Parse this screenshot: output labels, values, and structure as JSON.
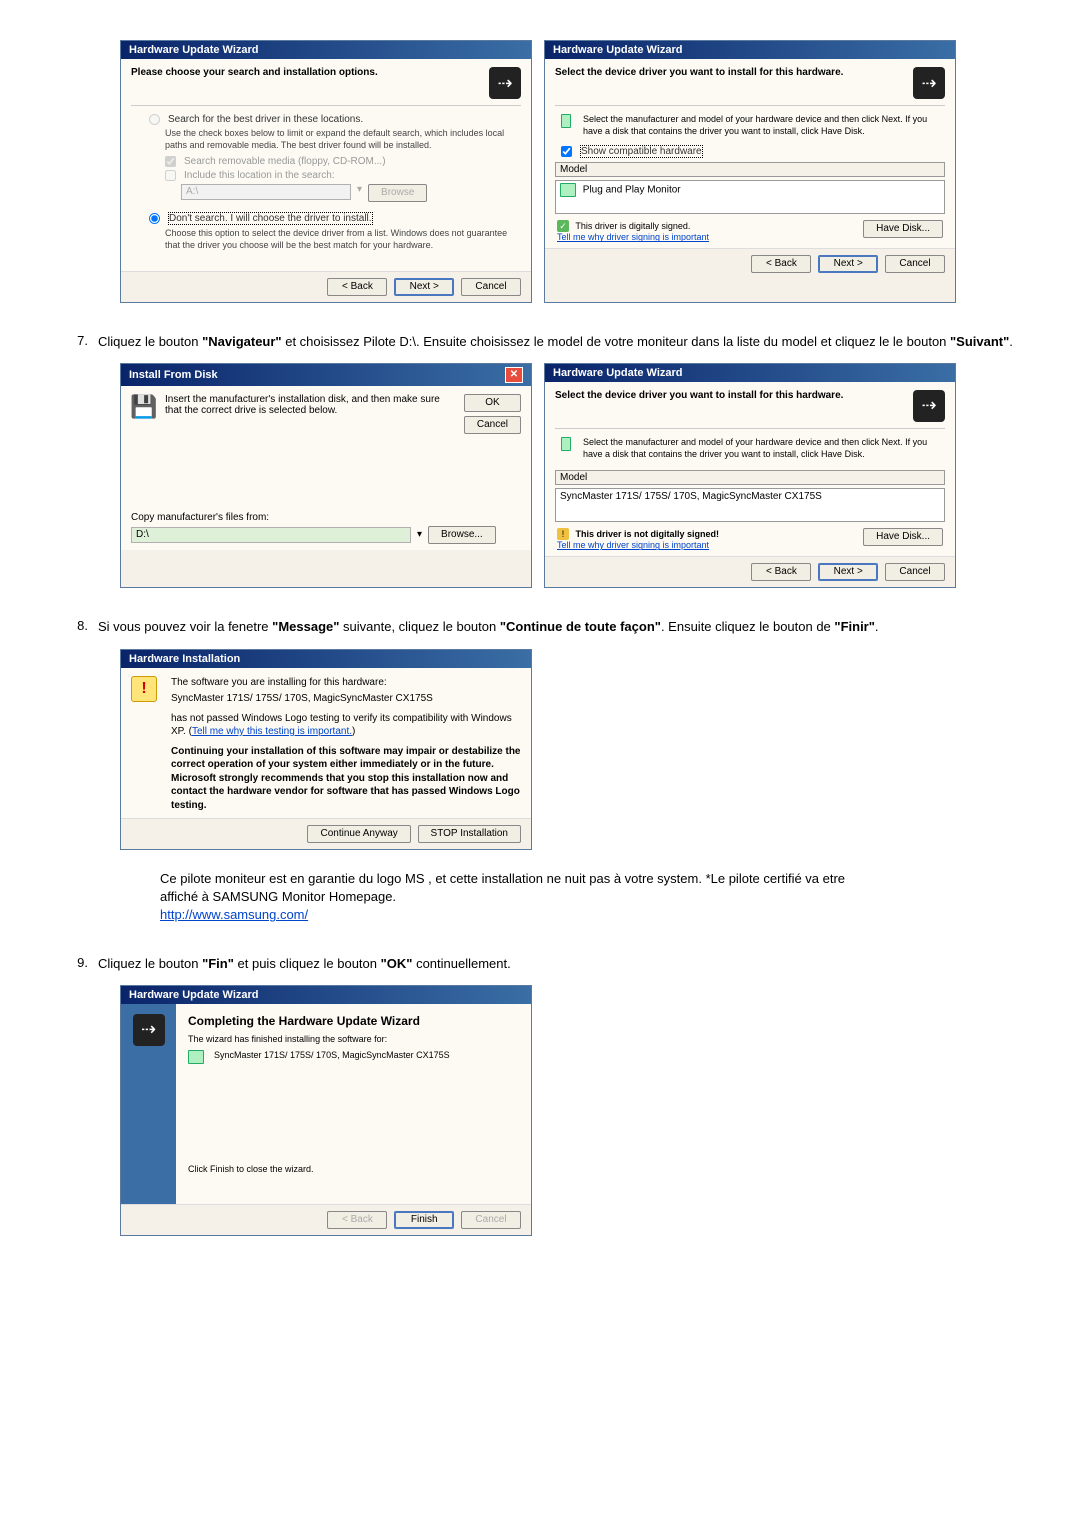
{
  "wizard1": {
    "title": "Hardware Update Wizard",
    "heading": "Please choose your search and installation options.",
    "radio1": "Search for the best driver in these locations.",
    "radio1_sub": "Use the check boxes below to limit or expand the default search, which includes local paths and removable media. The best driver found will be installed.",
    "check1": "Search removable media (floppy, CD-ROM...)",
    "check2": "Include this location in the search:",
    "pathValue": "A:\\",
    "browse": "Browse",
    "radio2": "Don't search. I will choose the driver to install.",
    "radio2_sub": "Choose this option to select the device driver from a list. Windows does not guarantee that the driver you choose will be the best match for your hardware.",
    "back": "< Back",
    "next": "Next >",
    "cancel": "Cancel"
  },
  "wizard2": {
    "title": "Hardware Update Wizard",
    "heading": "Select the device driver you want to install for this hardware.",
    "instruction": "Select the manufacturer and model of your hardware device and then click Next. If you have a disk that contains the driver you want to install, click Have Disk.",
    "showCompat": "Show compatible hardware",
    "modelLabel": "Model",
    "modelItem": "Plug and Play Monitor",
    "signedText": "This driver is digitally signed.",
    "tellLink": "Tell me why driver signing is important",
    "haveDisk": "Have Disk...",
    "back": "< Back",
    "next": "Next >",
    "cancel": "Cancel"
  },
  "step7": {
    "num": "7.",
    "textA": "Cliquez le bouton ",
    "boldA": "\"Navigateur\"",
    "textB": " et choisissez Pilote D:\\. Ensuite choisissez le model de votre moniteur dans la liste du model et cliquez le le bouton ",
    "boldB": "\"Suivant\"",
    "textC": "."
  },
  "installDisk": {
    "title": "Install From Disk",
    "inst": "Insert the manufacturer's installation disk, and then make sure that the correct drive is selected below.",
    "ok": "OK",
    "cancel": "Cancel",
    "copyLabel": "Copy manufacturer's files from:",
    "pathValue": "D:\\",
    "browse": "Browse..."
  },
  "wizard3": {
    "title": "Hardware Update Wizard",
    "heading": "Select the device driver you want to install for this hardware.",
    "instruction": "Select the manufacturer and model of your hardware device and then click Next. If you have a disk that contains the driver you want to install, click Have Disk.",
    "modelLabel": "Model",
    "modelItem": "SyncMaster 171S/ 175S/ 170S, MagicSyncMaster CX175S",
    "unsignedText": "This driver is not digitally signed!",
    "tellLink": "Tell me why driver signing is important",
    "haveDisk": "Have Disk...",
    "back": "< Back",
    "next": "Next >",
    "cancel": "Cancel"
  },
  "step8": {
    "num": "8.",
    "textA": "Si vous pouvez voir la fenetre ",
    "boldA": "\"Message\"",
    "textB": " suivante, cliquez le bouton ",
    "boldB": "\"Continue de toute façon\"",
    "textC": ". Ensuite cliquez le bouton de ",
    "boldC": "\"Finir\"",
    "textD": "."
  },
  "hwInstall": {
    "title": "Hardware Installation",
    "line1": "The software you are installing for this hardware:",
    "line2": "SyncMaster 171S/ 175S/ 170S, MagicSyncMaster CX175S",
    "line3": "has not passed Windows Logo testing to verify its compatibility with Windows XP. (",
    "linkText": "Tell me why this testing is important.",
    "line3end": ")",
    "warn": "Continuing your installation of this software may impair or destabilize the correct operation of your system either immediately or in the future. Microsoft strongly recommends that you stop this installation now and contact the hardware vendor for software that has passed Windows Logo testing.",
    "continue": "Continue Anyway",
    "stop": "STOP Installation"
  },
  "notes": {
    "line1": "Ce pilote moniteur est en garantie du logo MS , et cette installation ne nuit pas à votre system. *Le pilote certifié va etre affiché à SAMSUNG Monitor Homepage.",
    "link": "http://www.samsung.com/"
  },
  "step9": {
    "num": "9.",
    "textA": "Cliquez le bouton ",
    "boldA": "\"Fin\"",
    "textB": " et puis cliquez le bouton ",
    "boldB": "\"OK\"",
    "textC": " continuellement."
  },
  "complete": {
    "title": "Hardware Update Wizard",
    "heading": "Completing the Hardware Update Wizard",
    "line1": "The wizard has finished installing the software for:",
    "model": "SyncMaster 171S/ 175S/ 170S, MagicSyncMaster CX175S",
    "line2": "Click Finish to close the wizard.",
    "back": "< Back",
    "finish": "Finish",
    "cancel": "Cancel"
  }
}
